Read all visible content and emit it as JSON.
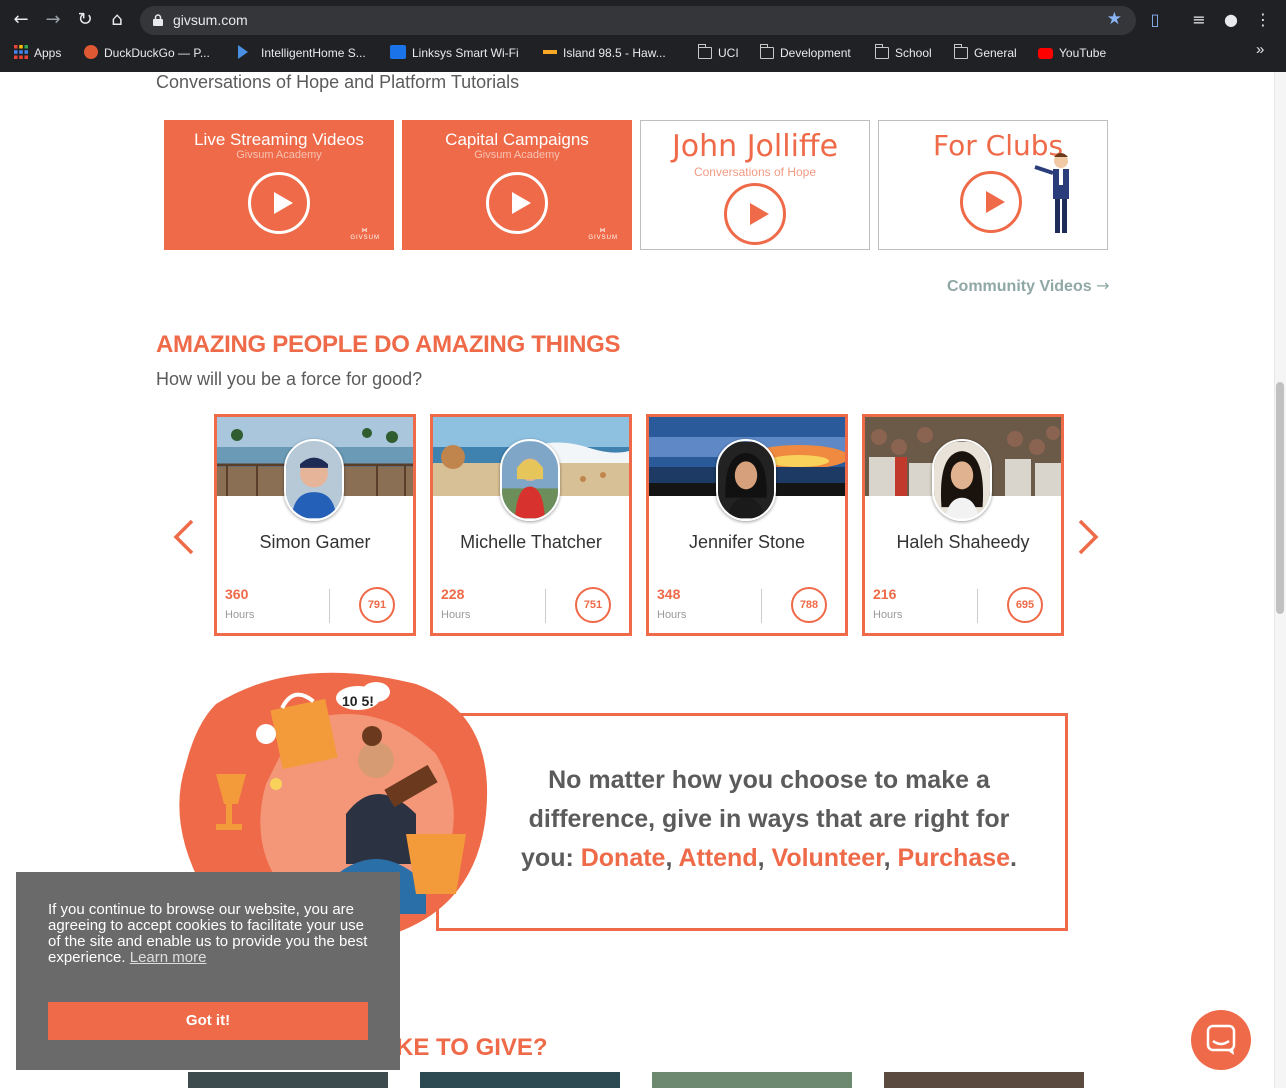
{
  "browser": {
    "url": "givsum.com",
    "bookmarks": [
      {
        "label": "Apps",
        "icon": "apps-grid-icon"
      },
      {
        "label": "DuckDuckGo — P...",
        "icon": "duckduckgo-icon"
      },
      {
        "label": "IntelligentHome S...",
        "icon": "play-triangle-icon"
      },
      {
        "label": "Linksys Smart Wi-Fi",
        "icon": "wifi-icon"
      },
      {
        "label": "Island 98.5 - Haw...",
        "icon": "radio-icon"
      },
      {
        "label": "UCI",
        "icon": "folder-icon"
      },
      {
        "label": "Development",
        "icon": "folder-icon"
      },
      {
        "label": "School",
        "icon": "folder-icon"
      },
      {
        "label": "General",
        "icon": "folder-icon"
      },
      {
        "label": "YouTube",
        "icon": "youtube-icon"
      }
    ],
    "more_label": "»"
  },
  "videos": {
    "subtitle": "Conversations of Hope and Platform Tutorials",
    "items": [
      {
        "title": "Live Streaming Videos",
        "sub": "Givsum Academy",
        "style": "filled"
      },
      {
        "title": "Capital Campaigns",
        "sub": "Givsum Academy",
        "style": "filled"
      },
      {
        "title": "John Jolliffe",
        "sub": "Conversations of Hope",
        "style": "outline"
      },
      {
        "title": "For Clubs",
        "sub": "",
        "style": "outline"
      }
    ],
    "logo_text": "GIVSUM",
    "community_link": "Community Videos"
  },
  "people": {
    "heading": "AMAZING PEOPLE DO AMAZING THINGS",
    "subheading": "How will you be a force for good?",
    "hours_label": "Hours",
    "cards": [
      {
        "name": "Simon Gamer",
        "hours": "360",
        "score": "791"
      },
      {
        "name": "Michelle Thatcher",
        "hours": "228",
        "score": "751"
      },
      {
        "name": "Jennifer Stone",
        "hours": "348",
        "score": "788"
      },
      {
        "name": "Haleh Shaheedy",
        "hours": "216",
        "score": "695"
      }
    ]
  },
  "message": {
    "text_start": "No matter how you choose to make a difference, give in ways that are right for you: ",
    "donate": "Donate",
    "attend": "Attend",
    "volunteer": "Volunteer",
    "purchase": "Purchase",
    "sep1": ", ",
    "sep2": ", ",
    "sep3": ", ",
    "end": "."
  },
  "cookie": {
    "text": "If you continue to browse our website, you are agreeing to accept cookies to facilitate your use of the site and enable us to provide you the best experience.",
    "learn_more": "Learn more",
    "button": "Got it!"
  },
  "bottom_heading": "KE TO GIVE?",
  "colors": {
    "accent": "#ef6a48",
    "muted_teal": "#8fa8a5",
    "chrome_bg": "#202124"
  }
}
